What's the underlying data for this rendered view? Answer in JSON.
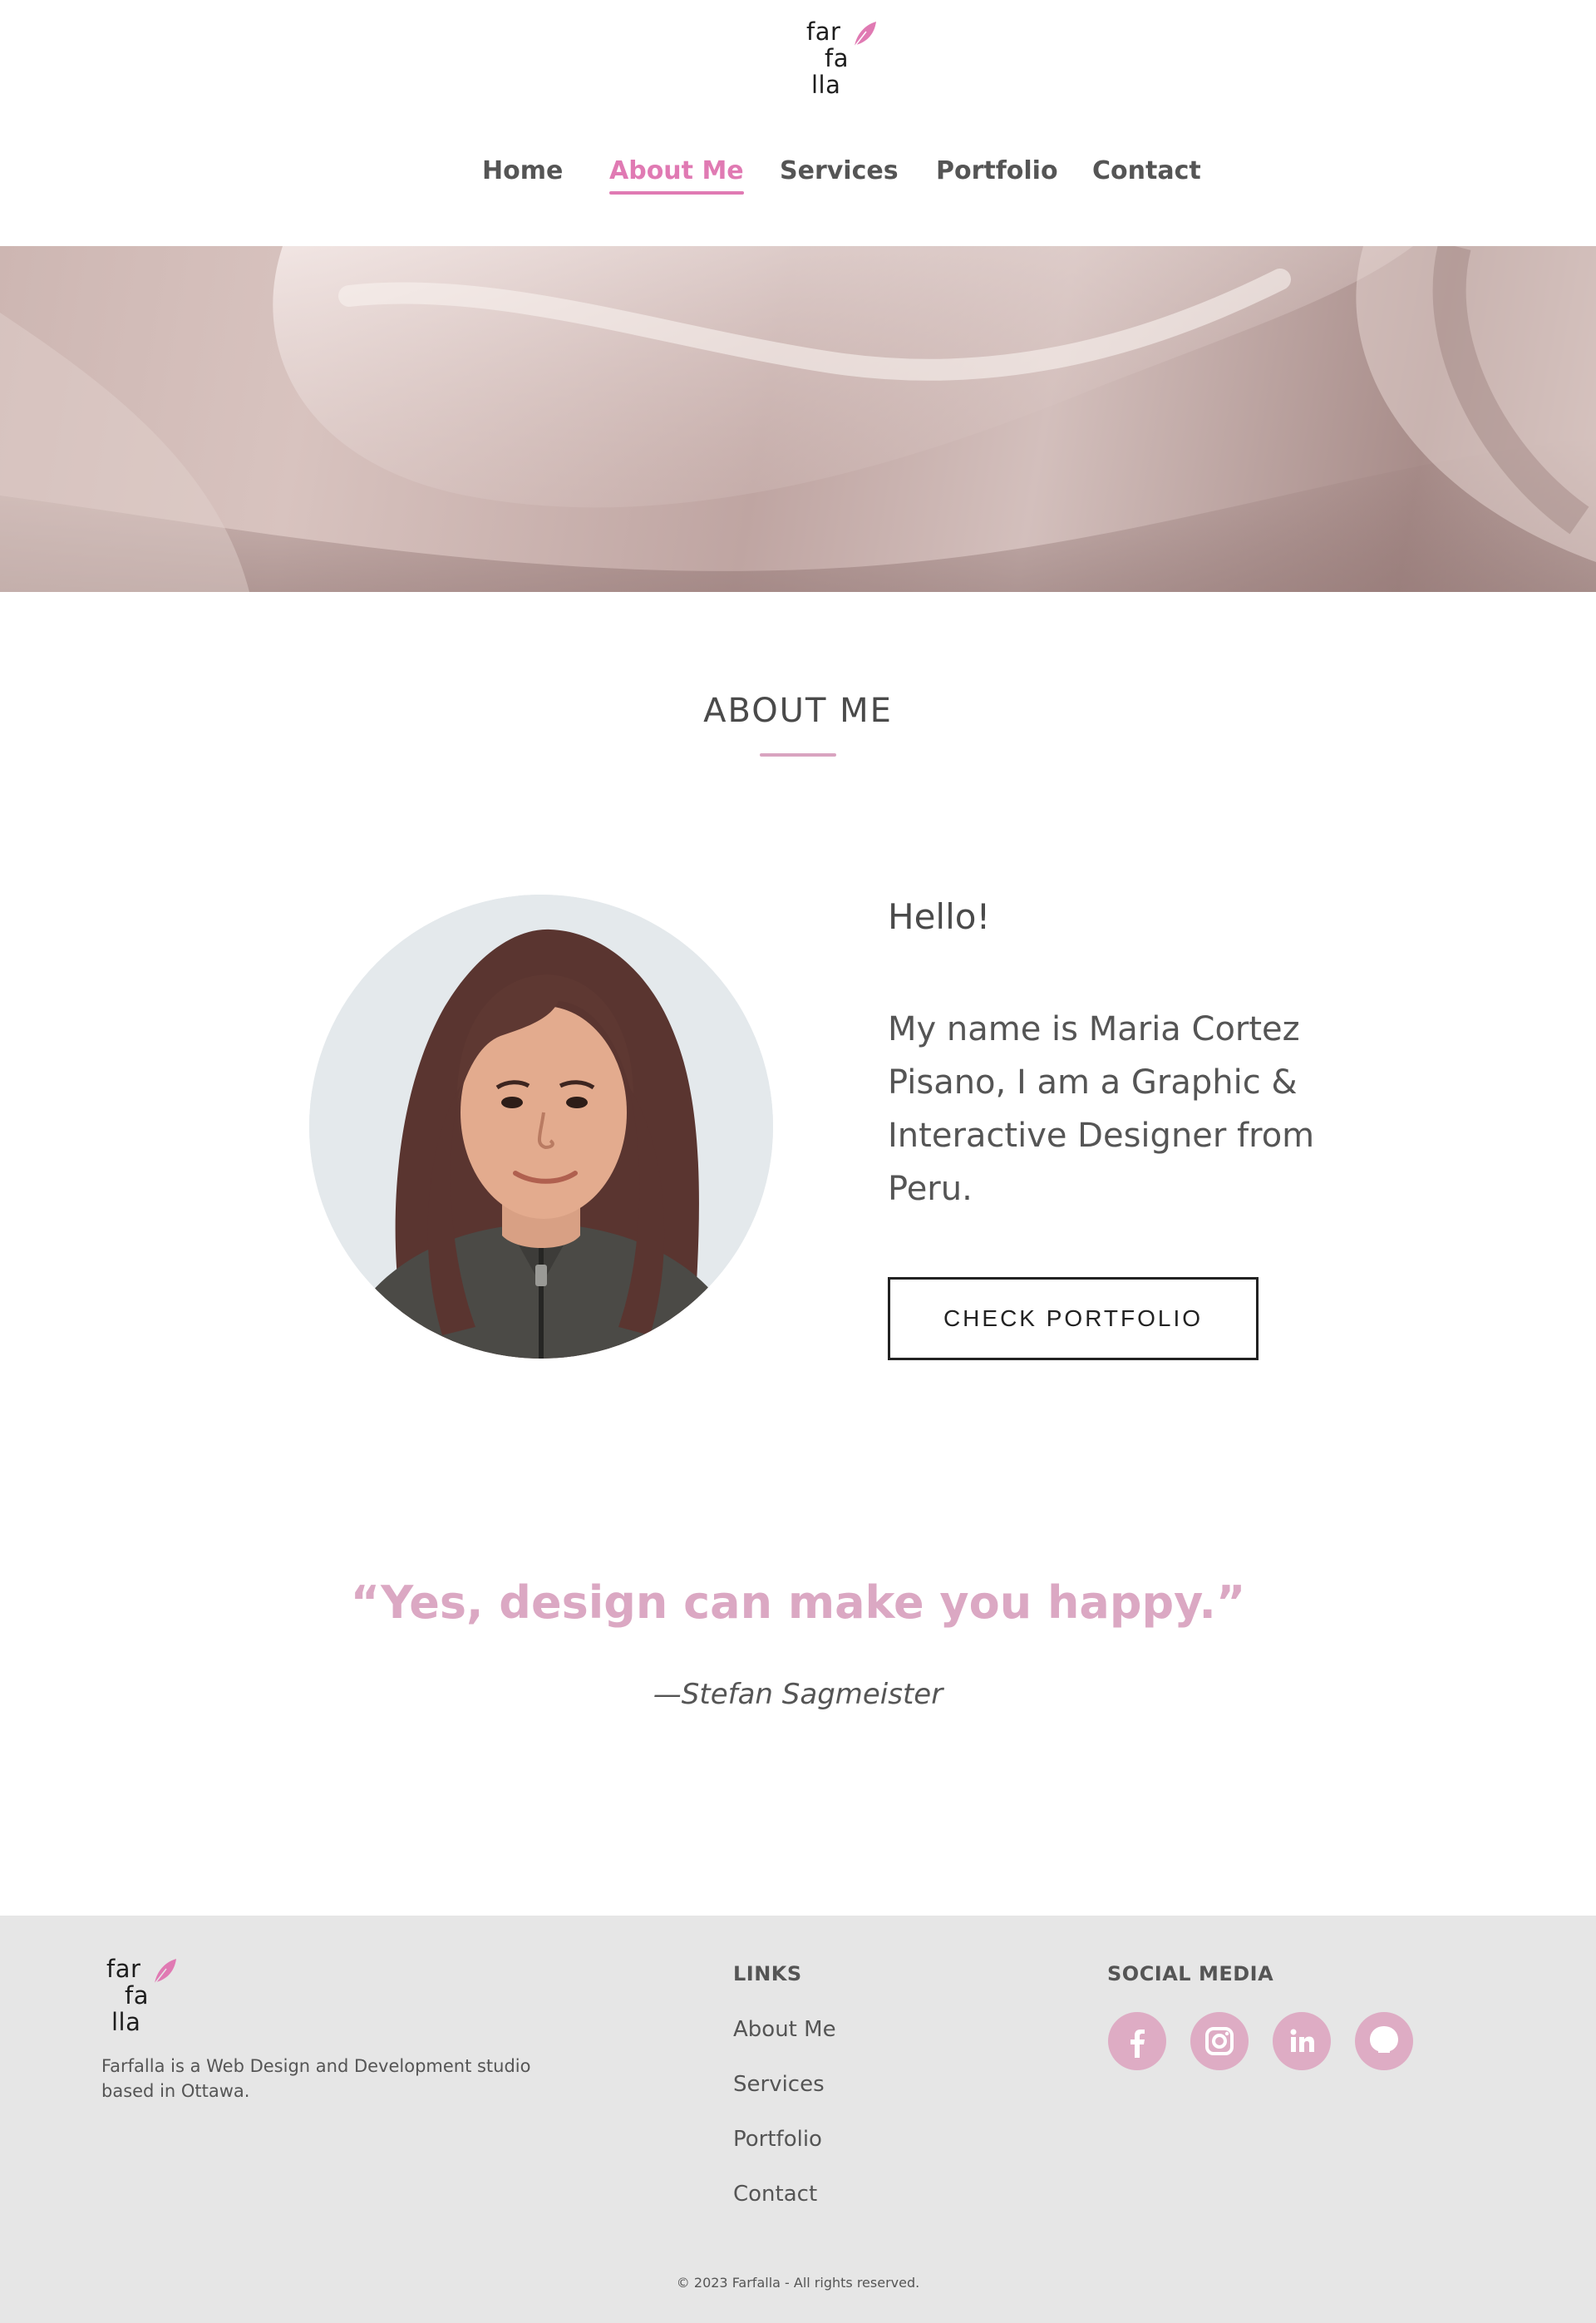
{
  "brand": {
    "logo_lines": [
      "far",
      "fa",
      "lla"
    ],
    "accent": "#e07ab3",
    "soft_accent": "#dba8c3"
  },
  "nav": {
    "items": [
      {
        "label": "Home",
        "active": false
      },
      {
        "label": "About Me",
        "active": true
      },
      {
        "label": "Services",
        "active": false
      },
      {
        "label": "Portfolio",
        "active": false
      },
      {
        "label": "Contact",
        "active": false
      }
    ]
  },
  "about": {
    "title": "ABOUT ME",
    "hello": "Hello!",
    "bio": "My name is Maria Cortez Pisano, I am a Graphic & Interactive Designer from Peru.",
    "button": "CHECK PORTFOLIO"
  },
  "quote": {
    "text": "“Yes, design can make you happy.”",
    "author": "—Stefan Sagmeister"
  },
  "footer": {
    "description": "Farfalla is a Web Design and Development studio based in Ottawa.",
    "links_heading": "LINKS",
    "links": [
      "About Me",
      "Services",
      "Portfolio",
      "Contact"
    ],
    "social_heading": "SOCIAL MEDIA",
    "social_icons": [
      "facebook-icon",
      "instagram-icon",
      "linkedin-icon",
      "github-icon"
    ],
    "social_color": "#deacc4",
    "copyright": "© 2023 Farfalla - All rights reserved."
  }
}
